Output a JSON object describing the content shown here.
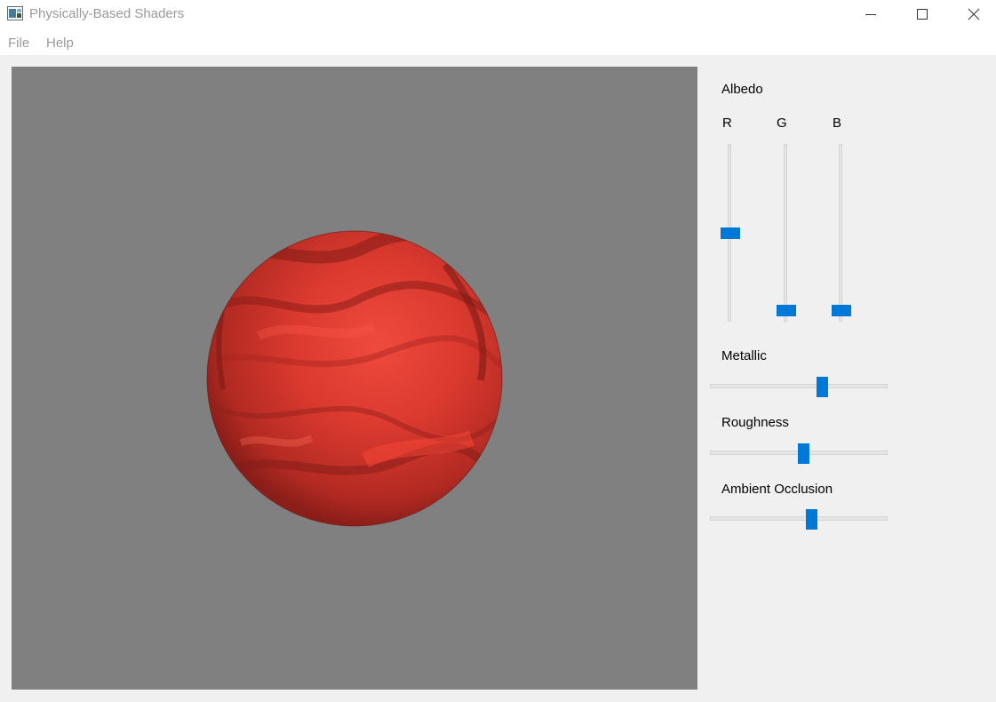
{
  "window": {
    "title": "Physically-Based Shaders",
    "icon": "app-window-icon",
    "controls": {
      "minimize": "minimize-icon",
      "maximize": "maximize-icon",
      "close": "close-icon"
    }
  },
  "menu": {
    "file": "File",
    "help": "Help"
  },
  "colors": {
    "accent": "#0078d7",
    "viewport_bg": "#808080",
    "sphere_base": "#d93a30"
  },
  "viewport": {
    "object": "sphere"
  },
  "panel": {
    "albedo": {
      "label": "Albedo",
      "channels": [
        {
          "label": "R",
          "value": 0.5
        },
        {
          "label": "G",
          "value": 0.03
        },
        {
          "label": "B",
          "value": 0.03
        }
      ]
    },
    "metallic": {
      "label": "Metallic",
      "value": 0.64
    },
    "roughness": {
      "label": "Roughness",
      "value": 0.53
    },
    "ambient_occlusion": {
      "label": "Ambient Occlusion",
      "value": 0.58
    }
  }
}
